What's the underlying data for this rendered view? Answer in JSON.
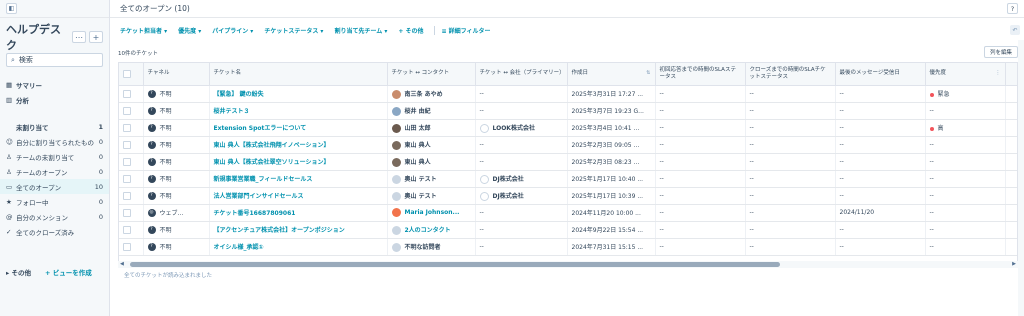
{
  "sidebar": {
    "title": "ヘルプデスク",
    "search_placeholder": "検索",
    "nav": [
      {
        "label": "サマリー",
        "count": "",
        "icon": "grid-icon",
        "bold": true
      },
      {
        "label": "分析",
        "count": "",
        "icon": "bar-chart-icon",
        "bold": true
      }
    ],
    "views": [
      {
        "label": "未割り当て",
        "count": "1",
        "icon": "",
        "bold": true
      },
      {
        "label": "自分に割り当てられたもの",
        "count": "0",
        "icon": "person-icon"
      },
      {
        "label": "チームの未割り当て",
        "count": "0",
        "icon": "team-icon"
      },
      {
        "label": "チームのオープン",
        "count": "0",
        "icon": "team-icon"
      },
      {
        "label": "全てのオープン",
        "count": "10",
        "icon": "inbox-icon",
        "active": true
      },
      {
        "label": "フォロー中",
        "count": "0",
        "icon": "star-icon"
      },
      {
        "label": "自分のメンション",
        "count": "0",
        "icon": "at-icon"
      },
      {
        "label": "全てのクローズ済み",
        "count": "",
        "icon": "check-icon"
      }
    ],
    "other_label": "その他",
    "create_view_label": "+ ビューを作成"
  },
  "header": {
    "title": "全てのオープン (10)",
    "help": "?"
  },
  "filters": [
    "チケット担当者 ▾",
    "優先度 ▾",
    "パイプライン ▾",
    "チケットステータス ▾",
    "割り当て先チーム ▾",
    "+ その他",
    "詳細フィルター"
  ],
  "table": {
    "count_label": "10件のチケット",
    "edit_columns_label": "列を編集",
    "headers": [
      "チャネル",
      "チケット名",
      "チケット ↔ コンタクト",
      "チケット ↔ 会社（プライマリー）",
      "作成日",
      "初回応答までの時間のSLAステータス",
      "クローズまでの時間のSLAチケットステータス",
      "最後のメッセージ受信日",
      "優先度"
    ],
    "rows": [
      {
        "channel": "不明",
        "name": "【緊急】 鍵の紛失",
        "contact": "南三条 あやめ",
        "company": "--",
        "created": "2025年3月31日 17:27 ...",
        "sla1": "--",
        "sla2": "--",
        "lastmsg": "--",
        "priority": "緊急"
      },
      {
        "channel": "不明",
        "name": "桜井テスト３",
        "contact": "桜井 由紀",
        "company": "--",
        "created": "2025年3月7日 19:23 G...",
        "sla1": "--",
        "sla2": "--",
        "lastmsg": "--",
        "priority": "--"
      },
      {
        "channel": "不明",
        "name": "Extension Spotエラーについて",
        "contact": "山田 太郎",
        "company": "LOOK株式会社",
        "created": "2025年3月4日 10:41 ...",
        "sla1": "--",
        "sla2": "--",
        "lastmsg": "--",
        "priority": "高"
      },
      {
        "channel": "不明",
        "name": "東山 典人【株式会社飛翔イノベーション】",
        "contact": "東山 典人",
        "company": "--",
        "created": "2025年2月3日 09:05 ...",
        "sla1": "--",
        "sla2": "--",
        "lastmsg": "--",
        "priority": "--"
      },
      {
        "channel": "不明",
        "name": "東山 典人【株式会社翠空ソリューション】",
        "contact": "東山 典人",
        "company": "--",
        "created": "2025年2月3日 08:23 ...",
        "sla1": "--",
        "sla2": "--",
        "lastmsg": "--",
        "priority": "--"
      },
      {
        "channel": "不明",
        "name": "新規事業営業職_フィールドセールス",
        "contact": "奥山 テスト",
        "company": "DJ株式会社",
        "created": "2025年1月17日 10:40 ...",
        "sla1": "--",
        "sla2": "--",
        "lastmsg": "--",
        "priority": "--"
      },
      {
        "channel": "不明",
        "name": "法人営業部門インサイドセールス",
        "contact": "奥山 テスト",
        "company": "DJ株式会社",
        "created": "2025年1月17日 10:39 ...",
        "sla1": "--",
        "sla2": "--",
        "lastmsg": "--",
        "priority": "--"
      },
      {
        "channel": "ウェブ...",
        "name": "チケット番号16687809061",
        "contact": "Maria Johnson...",
        "company": "--",
        "created": "2024年11月20 10:00 ...",
        "sla1": "--",
        "sla2": "--",
        "lastmsg": "2024/11/20",
        "priority": "--"
      },
      {
        "channel": "不明",
        "name": "【アクセンチュア株式会社】オープンポジション",
        "contact": "2人のコンタクト",
        "company": "--",
        "created": "2024年9月22日 15:54 ...",
        "sla1": "--",
        "sla2": "--",
        "lastmsg": "--",
        "priority": "--"
      },
      {
        "channel": "不明",
        "name": "オイシル様_承認①",
        "contact": "不明な訪問者",
        "company": "--",
        "created": "2024年7月31日 15:15 ...",
        "sla1": "--",
        "sla2": "--",
        "lastmsg": "--",
        "priority": "--"
      }
    ],
    "footer_note": "全てのチケットが読み込まれました"
  },
  "colors": {
    "accent": "#0091ae",
    "urgent": "#f2545b",
    "text": "#33475b",
    "active_bg": "#e5f5f8"
  }
}
